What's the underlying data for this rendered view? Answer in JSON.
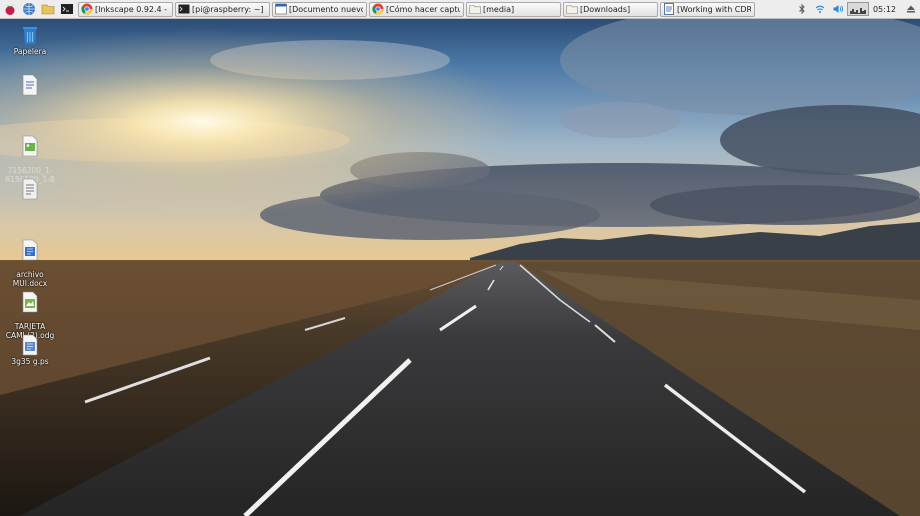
{
  "taskbar": {
    "launchers": [
      {
        "name": "raspberry-menu-icon"
      },
      {
        "name": "web-browser-icon"
      },
      {
        "name": "file-manager-icon"
      },
      {
        "name": "terminal-icon"
      }
    ],
    "tasks": [
      {
        "label": "[Inkscape 0.92.4 - GN...",
        "icon": "chrome-icon"
      },
      {
        "label": "[pi@raspberry: ~]",
        "icon": "terminal-icon"
      },
      {
        "label": "[Documento nuevo 1 ...",
        "icon": "document-icon"
      },
      {
        "label": "[Cómo hacer captura...",
        "icon": "chrome-icon"
      },
      {
        "label": "[media]",
        "icon": "folder-icon"
      },
      {
        "label": "[Downloads]",
        "icon": "folder-icon"
      },
      {
        "label": "[Working with CDR fil...",
        "icon": "word-icon"
      }
    ],
    "tray": {
      "icons": [
        "bluetooth-icon",
        "wifi-icon",
        "volume-icon",
        "cpu-monitor-icon"
      ],
      "clock": "05:12",
      "eject": "eject-icon"
    }
  },
  "desktop": {
    "icons": [
      {
        "label": "Papelera",
        "icon": "trash-icon"
      },
      {
        "label": "",
        "icon": "document-icon"
      },
      {
        "label": "7156200_1-\n8156100_1-8",
        "icon": "image-file-icon"
      },
      {
        "label": "",
        "icon": "text-file-icon"
      },
      {
        "label": "archivo\nMUI.docx",
        "icon": "docx-file-icon"
      },
      {
        "label": "TARJETA\nCAMI (2).odg",
        "icon": "odg-file-icon"
      },
      {
        "label": "3g35 g.ps",
        "icon": "ps-file-icon"
      }
    ]
  },
  "colors": {
    "taskbar_bg": "#ededed",
    "sky_top": "#1e3d63",
    "horizon_glow": "#fff3cf",
    "road": "#2b2b2d"
  }
}
